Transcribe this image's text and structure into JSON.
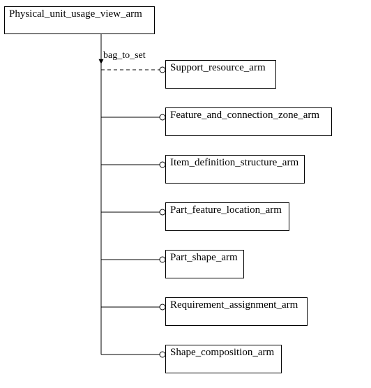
{
  "diagram": {
    "root": {
      "label": "Physical_unit_usage_view_arm"
    },
    "edge_label": "bag_to_set",
    "children": [
      {
        "label": "Support_resource_arm"
      },
      {
        "label": "Feature_and_connection_zone_arm"
      },
      {
        "label": "Item_definition_structure_arm"
      },
      {
        "label": "Part_feature_location_arm"
      },
      {
        "label": "Part_shape_arm"
      },
      {
        "label": "Requirement_assignment_arm"
      },
      {
        "label": "Shape_composition_arm"
      }
    ]
  }
}
